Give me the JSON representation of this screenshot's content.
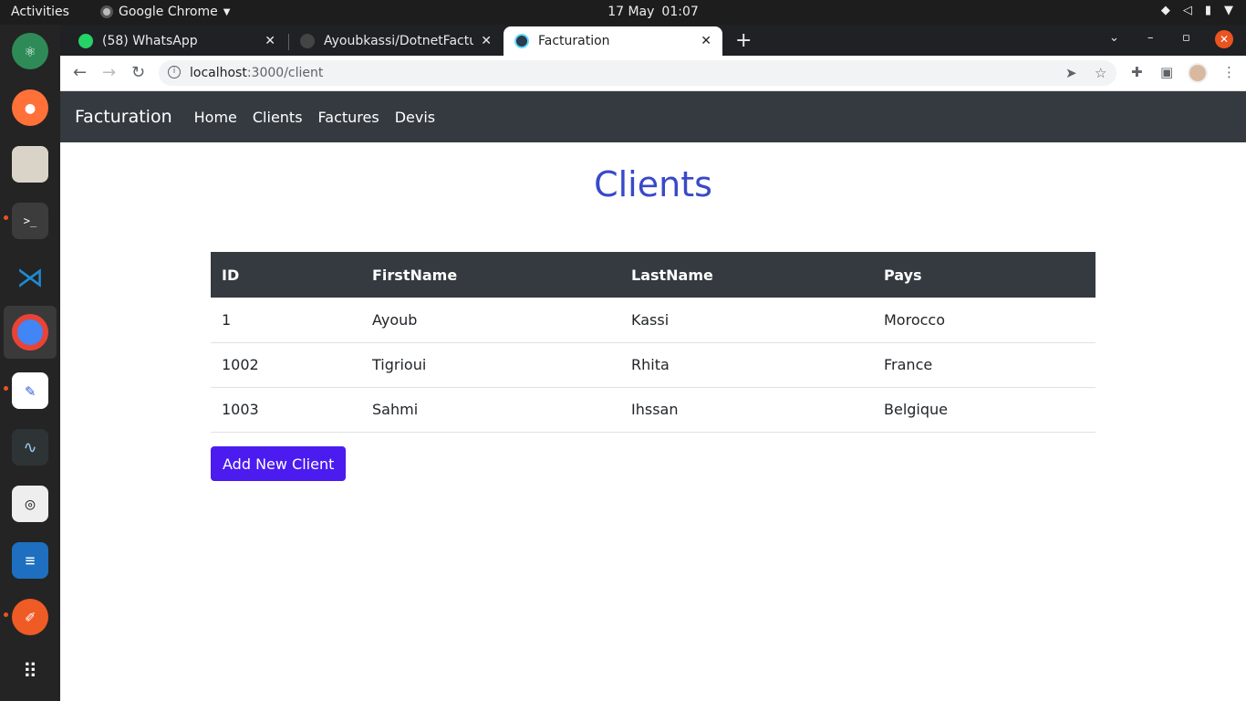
{
  "system": {
    "activities": "Activities",
    "app_menu": "Google Chrome",
    "date": "17 May",
    "time": "01:07"
  },
  "browser": {
    "tabs": [
      {
        "label": "(58) WhatsApp",
        "icon": "whatsapp-icon",
        "active": false
      },
      {
        "label": "Ayoubkassi/DotnetFactur",
        "icon": "github-icon",
        "active": false
      },
      {
        "label": "Facturation",
        "icon": "react-icon",
        "active": true
      }
    ],
    "url_host": "localhost",
    "url_path": ":3000/client"
  },
  "navbar": {
    "brand": "Facturation",
    "links": [
      "Home",
      "Clients",
      "Factures",
      "Devis"
    ]
  },
  "main": {
    "title": "Clients",
    "table": {
      "headers": [
        "ID",
        "FirstName",
        "LastName",
        "Pays"
      ],
      "rows": [
        [
          "1",
          "Ayoub",
          "Kassi",
          "Morocco"
        ],
        [
          "1002",
          "Tigrioui",
          "Rhita",
          "France"
        ],
        [
          "1003",
          "Sahmi",
          "Ihssan",
          "Belgique"
        ]
      ]
    },
    "add_button": "Add New Client"
  },
  "colors": {
    "title": "#3949c8",
    "navbar": "#343a40",
    "button": "#4b1bf0"
  }
}
